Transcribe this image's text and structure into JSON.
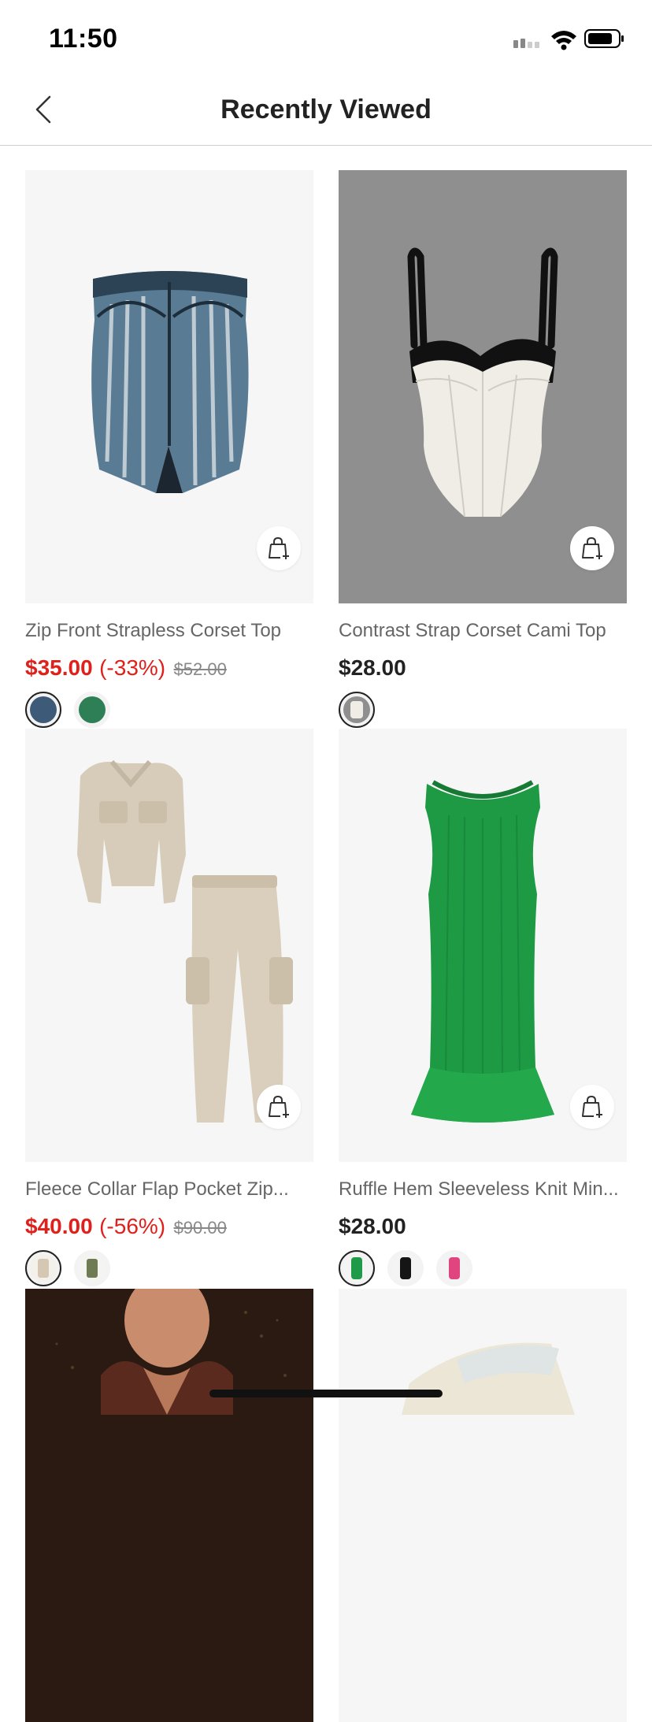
{
  "status_bar": {
    "time": "11:50"
  },
  "nav": {
    "title": "Recently Viewed"
  },
  "products": [
    {
      "name": "Zip Front Strapless Corset Top",
      "price": "$35.00",
      "discount": "(-33%)",
      "original_price": "$52.00",
      "on_sale": true,
      "swatch_colors": [
        "#3d5b78",
        "#2f7f56"
      ]
    },
    {
      "name": "Contrast Strap Corset Cami Top",
      "price": "$28.00",
      "discount": "",
      "original_price": "",
      "on_sale": false,
      "swatch_colors": [
        "#e8e6e0"
      ]
    },
    {
      "name": "Fleece Collar Flap Pocket Zip...",
      "price": "$40.00",
      "discount": "(-56%)",
      "original_price": "$90.00",
      "on_sale": true,
      "swatch_colors": [
        "#d4c8b4",
        "#6f7b52"
      ]
    },
    {
      "name": "Ruffle Hem Sleeveless Knit Min...",
      "price": "$28.00",
      "discount": "",
      "original_price": "",
      "on_sale": false,
      "swatch_colors": [
        "#1f9a48",
        "#151515",
        "#e0457f"
      ]
    },
    {
      "name": "",
      "price": "",
      "discount": "",
      "original_price": "",
      "on_sale": false,
      "swatch_colors": []
    },
    {
      "name": "",
      "price": "",
      "discount": "",
      "original_price": "",
      "on_sale": false,
      "swatch_colors": []
    }
  ],
  "colors": {
    "sale_red": "#e0201a",
    "text_dark": "#222222",
    "text_gray": "#666666",
    "image_bg": "#f6f6f6"
  }
}
